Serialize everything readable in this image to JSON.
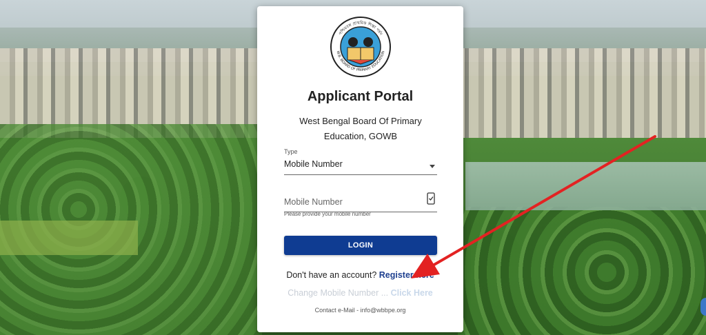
{
  "logo": {
    "icon": "board-emblem-logo",
    "arc_top": "পশ্চিমবঙ্গ প্রাথমিক শিক্ষা পর্ষদ",
    "arc_bottom": "W.B. BOARD OF PRIMARY EDUCATION"
  },
  "title": "Applicant Portal",
  "subtitle": "West Bengal Board Of Primary Education, GOWB",
  "type_field": {
    "label": "Type",
    "value": "Mobile Number"
  },
  "mobile_field": {
    "placeholder": "Mobile Number",
    "hint": "Please provide your mobile number",
    "icon": "phone-icon"
  },
  "login_label": "LOGIN",
  "register": {
    "prompt": "Don't have an account?",
    "link": "Register here"
  },
  "change_mobile": {
    "prompt": "Change Mobile Number ...",
    "link": "Click Here"
  },
  "contact": "Contact e-Mail - info@wbbpe.org",
  "colors": {
    "primary": "#0f3c92",
    "link": "#1d3f8f",
    "arrow": "#e32222"
  }
}
